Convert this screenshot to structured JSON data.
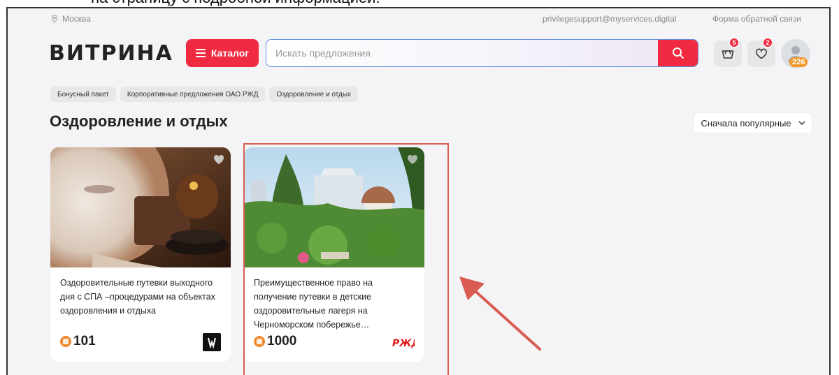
{
  "doc_caption": "на страницу с подробной информацией.",
  "topbar": {
    "city": "Москва",
    "email": "privilegesupport@myservices.digital",
    "feedback": "Форма обратной связи"
  },
  "header": {
    "logo": "ВИТРИНА",
    "catalog_label": "Каталог",
    "search_placeholder": "Искать предложения",
    "cart_count": "5",
    "favorites_count": "2",
    "points": "226"
  },
  "breadcrumbs": [
    "Бонусный пакет",
    "Корпоративные предложения ОАО РЖД",
    "Оздоровление и отдых"
  ],
  "page_title": "Оздоровление и отдых",
  "sort_label": "Сначала популярные",
  "cards": [
    {
      "description": "Оздоровительные путевки выходного дня с СПА –процедурами на объектах оздоровления и отдыха",
      "price": "101",
      "brand_icon": "partner-logo-icon"
    },
    {
      "description": "Преимущественное право на получение путевки в детские оздоровительные лагеря на Черноморском побережье…",
      "price": "1000",
      "brand": "РЖД",
      "brand_icon": "rzd-logo-icon"
    }
  ],
  "colors": {
    "accent": "#ef2a41",
    "points": "#f08a2e",
    "annotation": "#d95c52"
  }
}
